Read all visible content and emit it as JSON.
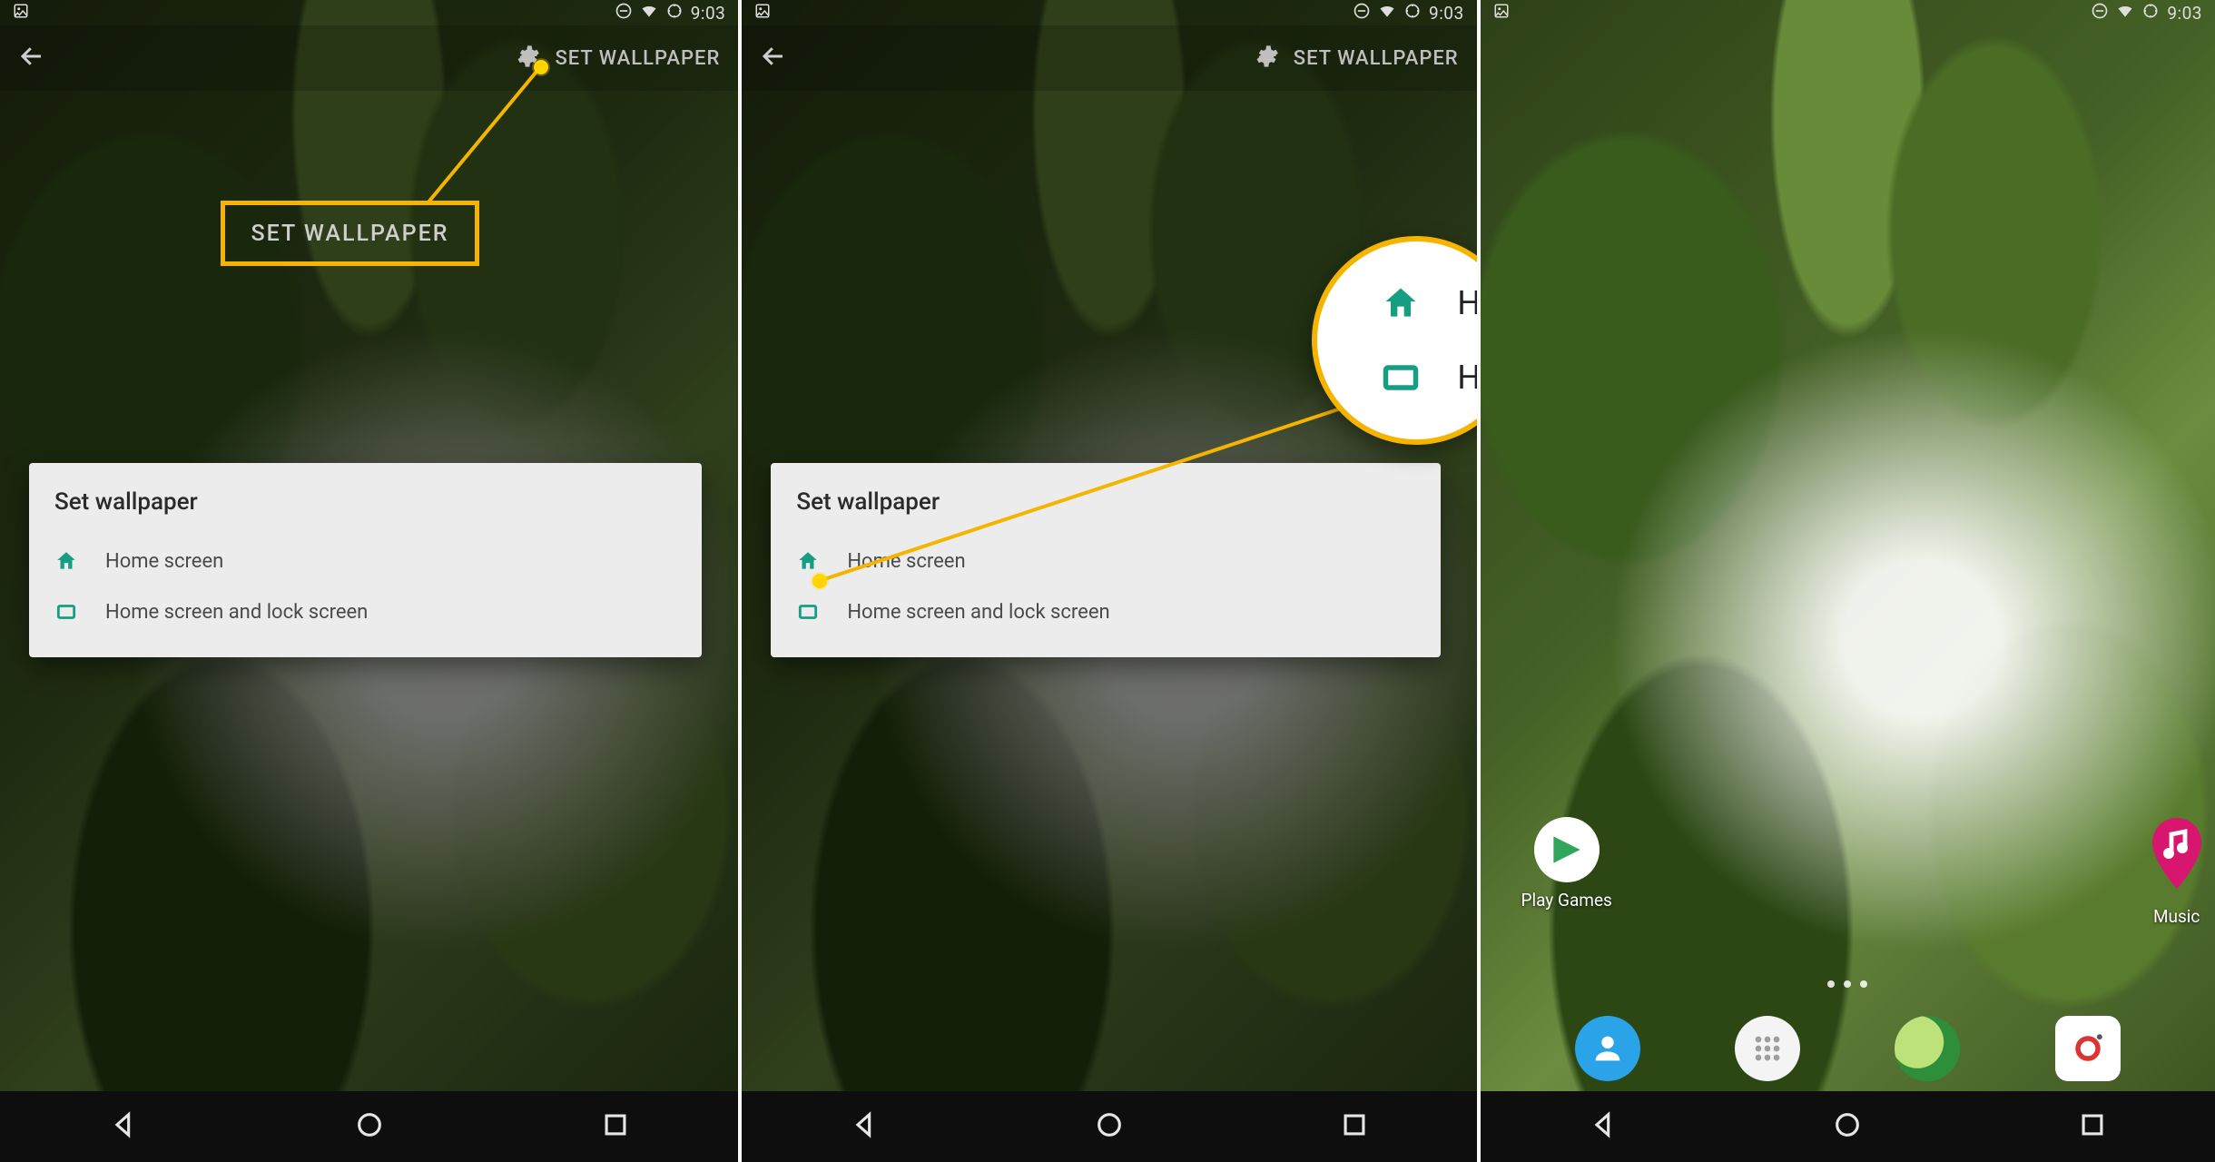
{
  "status": {
    "time": "9:03"
  },
  "toolbar": {
    "set_wallpaper": "SET WALLPAPER"
  },
  "callout": {
    "label": "SET WALLPAPER"
  },
  "dialog": {
    "title": "Set wallpaper",
    "opt_home": "Home screen",
    "opt_both": "Home screen and lock screen"
  },
  "lens": {
    "row1": "H",
    "row2": "H"
  },
  "home": {
    "app_play_games": "Play Games",
    "app_music": "Music"
  }
}
